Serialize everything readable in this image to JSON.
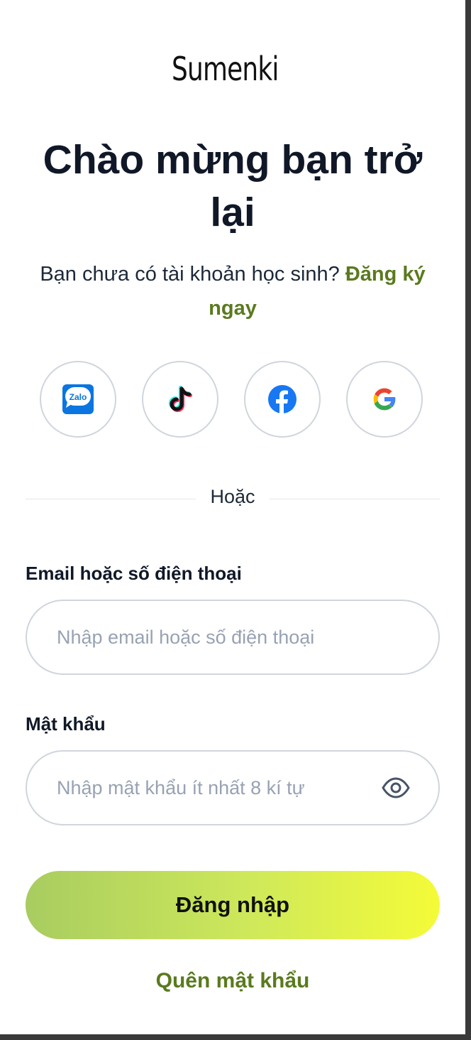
{
  "brand": {
    "name": "Sumenki",
    "icon": "dragonfly-logo",
    "color": "#8cc63f"
  },
  "heading": {
    "title": "Chào mừng bạn trở lại"
  },
  "signup": {
    "prompt": "Bạn chưa có tài khoản học sinh?",
    "link": "Đăng ký ngay"
  },
  "social": [
    {
      "name": "Zalo",
      "icon": "zalo-icon"
    },
    {
      "name": "TikTok",
      "icon": "tiktok-icon"
    },
    {
      "name": "Facebook",
      "icon": "facebook-icon"
    },
    {
      "name": "Google",
      "icon": "google-icon"
    }
  ],
  "divider": {
    "text": "Hoặc"
  },
  "form": {
    "email_label": "Email hoặc số điện thoại",
    "email_placeholder": "Nhập email hoặc số điện thoại",
    "email_value": "",
    "password_label": "Mật khẩu",
    "password_placeholder": "Nhập mật khẩu ít nhất 8 kí tự",
    "password_value": "",
    "show_password_icon": "eye-icon"
  },
  "actions": {
    "login": "Đăng nhập",
    "forgot": "Quên mật khẩu"
  },
  "colors": {
    "accent_text": "#5a7a1e",
    "button_gradient_start": "#a8cc60",
    "button_gradient_end": "#f4fb37"
  }
}
